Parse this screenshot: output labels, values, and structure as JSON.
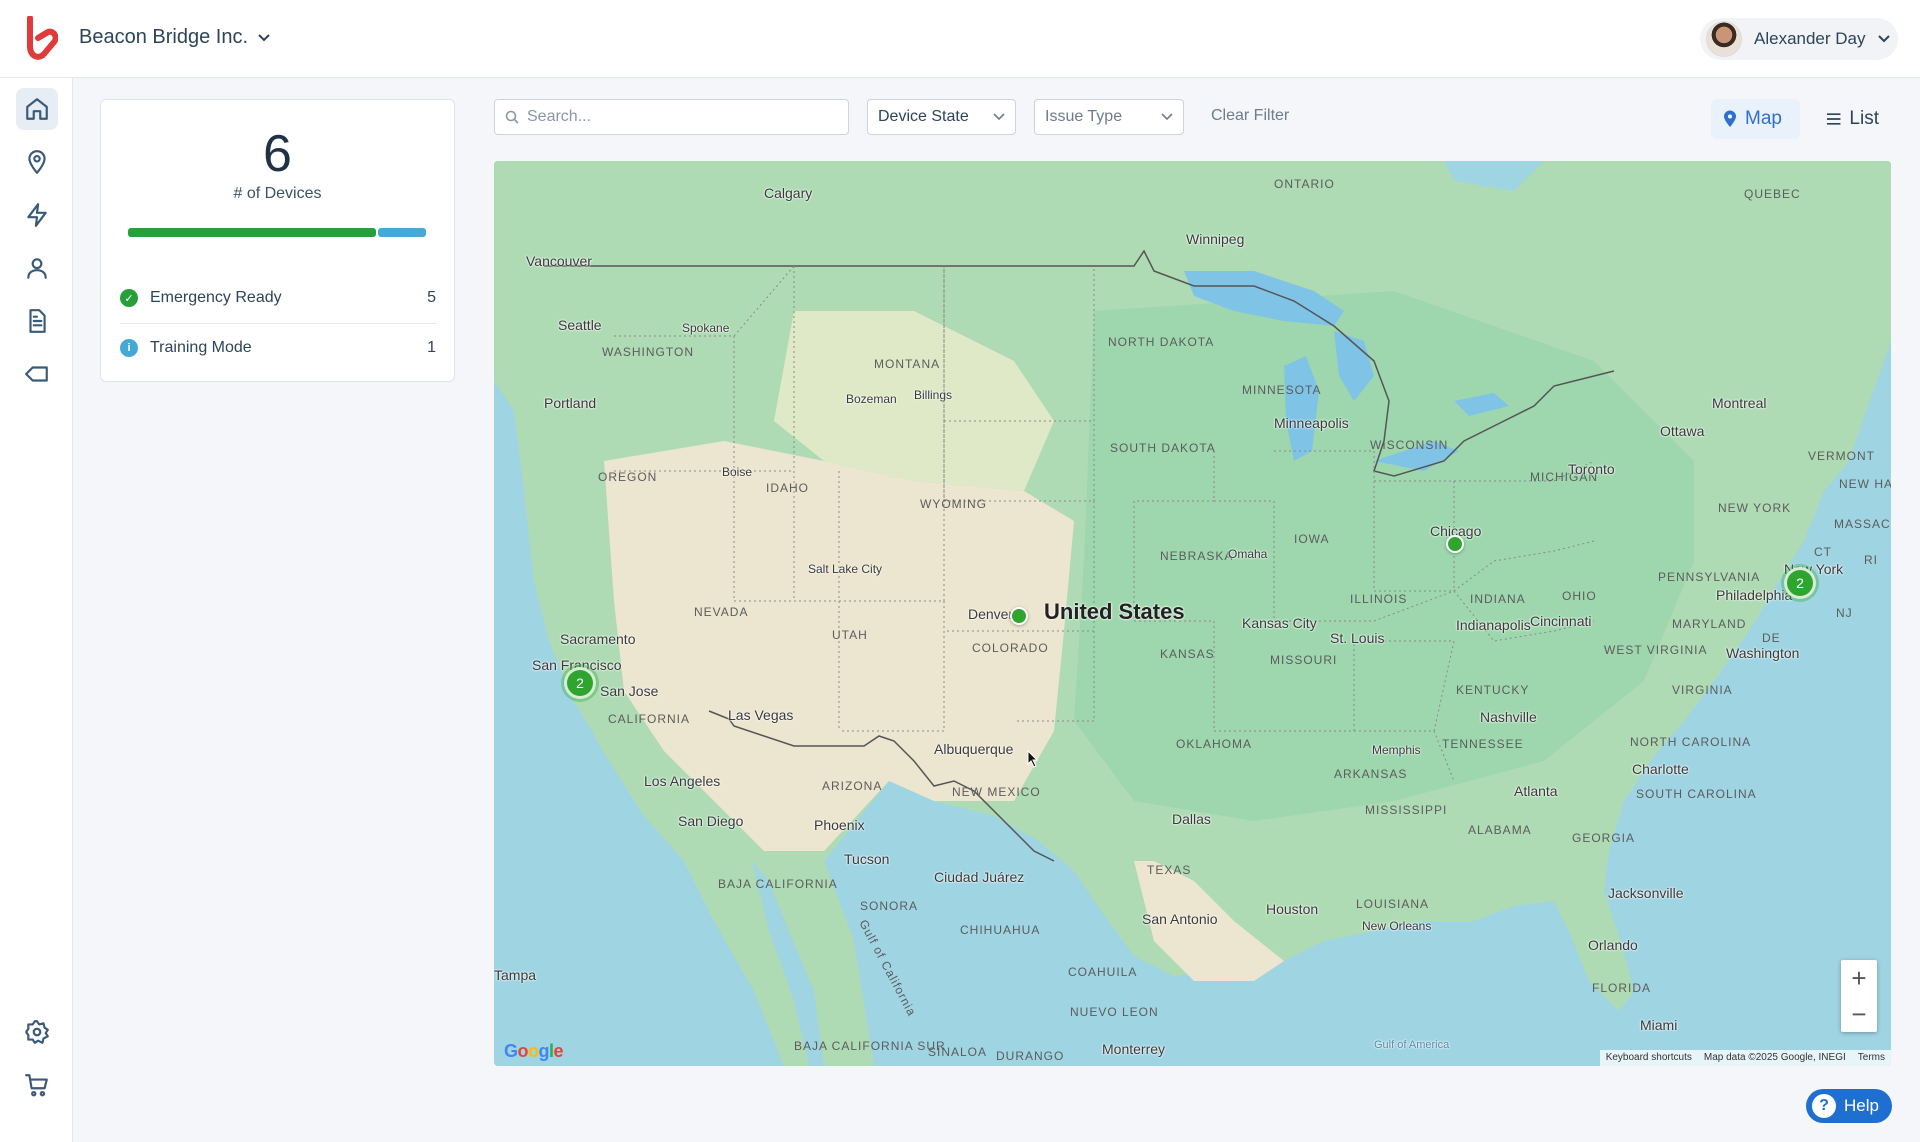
{
  "header": {
    "org_name": "Beacon Bridge Inc.",
    "user_name": "Alexander Day"
  },
  "sidebar": {
    "items": [
      {
        "name": "home-icon",
        "active": true
      },
      {
        "name": "location-pin-icon",
        "active": false
      },
      {
        "name": "lightning-icon",
        "active": false
      },
      {
        "name": "person-icon",
        "active": false
      },
      {
        "name": "document-icon",
        "active": false
      },
      {
        "name": "tag-icon",
        "active": false
      }
    ],
    "bottom_items": [
      {
        "name": "gear-icon"
      },
      {
        "name": "cart-icon"
      }
    ]
  },
  "summary": {
    "device_count": "6",
    "device_count_label": "# of Devices",
    "progress": [
      {
        "fraction": 0.8333,
        "color": "#27a03c"
      },
      {
        "fraction": 0.1667,
        "color": "#45a9d6"
      }
    ],
    "states": [
      {
        "label": "Emergency Ready",
        "count": "5",
        "color": "#27a03c",
        "icon": "check-icon"
      },
      {
        "label": "Training Mode",
        "count": "1",
        "color": "#45a9d6",
        "icon": "info-icon"
      }
    ]
  },
  "filters": {
    "search_placeholder": "Search...",
    "device_state": "Device State",
    "issue_type": "Issue Type",
    "clear": "Clear Filter"
  },
  "view_toggle": {
    "map": "Map",
    "list": "List",
    "active": "map"
  },
  "map": {
    "cities": [
      "Calgary",
      "Winnipeg",
      "Vancouver",
      "Seattle",
      "Spokane",
      "Portland",
      "Boise",
      "Bozeman",
      "Billings",
      "Minneapolis",
      "Montreal",
      "Ottawa",
      "Toronto",
      "Chicago",
      "Omaha",
      "Salt Lake City",
      "Denver",
      "United States",
      "Sacramento",
      "San Francisco",
      "San Jose",
      "Las Vegas",
      "Kansas City",
      "St. Louis",
      "Indianapolis",
      "Cincinnati",
      "Philadelphia",
      "New York",
      "Washington",
      "Nashville",
      "Memphis",
      "Albuquerque",
      "Los Angeles",
      "San Diego",
      "Phoenix",
      "Tucson",
      "Ciudad Juárez",
      "Dallas",
      "Charlotte",
      "Atlanta",
      "San Antonio",
      "Houston",
      "New Orleans",
      "Jacksonville",
      "Orlando",
      "Tampa",
      "Miami",
      "Monterrey",
      "Gulf of America"
    ],
    "regions": [
      "ONTARIO",
      "QUEBEC",
      "WASHINGTON",
      "MONTANA",
      "NORTH DAKOTA",
      "MINNESOTA",
      "SOUTH DAKOTA",
      "WISCONSIN",
      "MICHIGAN",
      "VERMONT",
      "NEW HAMPSHIRE",
      "MASSACHUSETTS",
      "OREGON",
      "IDAHO",
      "WYOMING",
      "NEW YORK",
      "IOWA",
      "NEBRASKA",
      "CT",
      "RI",
      "NEVADA",
      "UTAH",
      "COLORADO",
      "ILLINOIS",
      "INDIANA",
      "OHIO",
      "PENNSYLVANIA",
      "MARYLAND",
      "NJ",
      "DE",
      "KANSAS",
      "MISSOURI",
      "WEST VIRGINIA",
      "VIRGINIA",
      "CALIFORNIA",
      "KENTUCKY",
      "OKLAHOMA",
      "TENNESSEE",
      "NORTH CAROLINA",
      "ARIZONA",
      "NEW MEXICO",
      "ARKANSAS",
      "SOUTH CAROLINA",
      "MISSISSIPPI",
      "ALABAMA",
      "GEORGIA",
      "TEXAS",
      "LOUISIANA",
      "BAJA CALIFORNIA",
      "SONORA",
      "CHIHUAHUA",
      "COAHUILA",
      "NUEVO LEON",
      "FLORIDA",
      "BAJA CALIFORNIA SUR",
      "SINALOA",
      "DURANGO",
      "Gulf of California"
    ],
    "markers": [
      {
        "place": "Denver",
        "count": null
      },
      {
        "place": "Chicago",
        "count": null
      },
      {
        "place": "San Francisco",
        "count": "2"
      },
      {
        "place": "New York",
        "count": "2"
      }
    ],
    "attribution": {
      "keyboard": "Keyboard shortcuts",
      "data": "Map data ©2025 Google, INEGI",
      "terms": "Terms",
      "logo": "Google"
    },
    "zoom_in": "+",
    "zoom_out": "−"
  },
  "help": {
    "label": "Help"
  }
}
